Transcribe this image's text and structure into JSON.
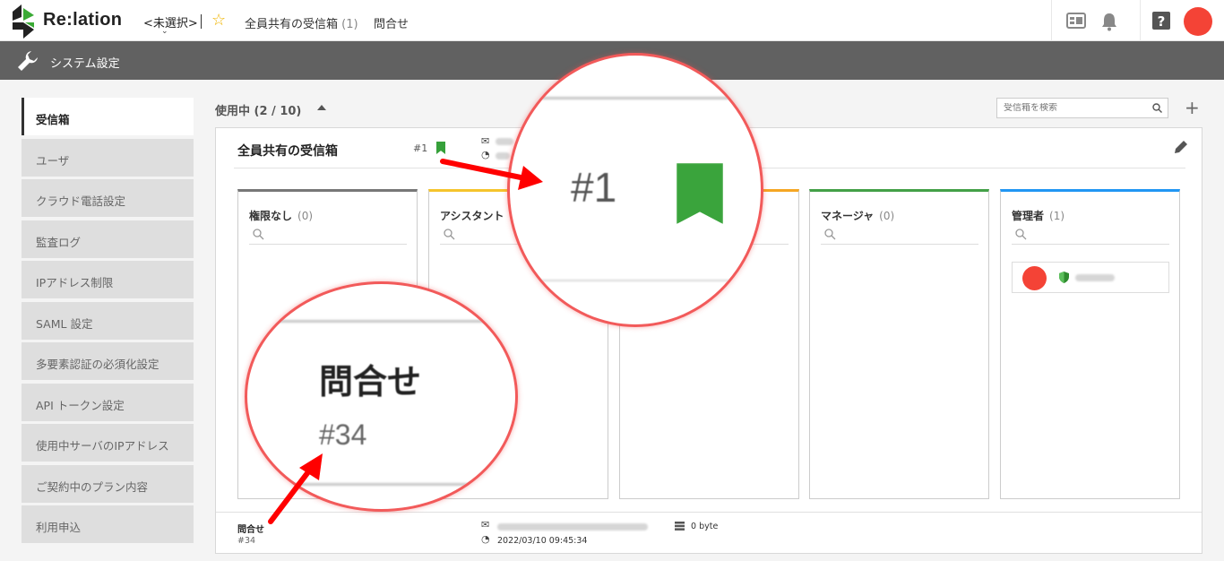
{
  "header": {
    "logo_text": "Re:lation",
    "inbox_selector": "<未選択>",
    "favorites": [
      {
        "label": "全員共有の受信箱",
        "count": "(1)"
      },
      {
        "label": "問合せ",
        "count": ""
      }
    ],
    "icons": [
      "widget-icon",
      "bell-icon",
      "help-icon",
      "avatar"
    ]
  },
  "subbar": {
    "title": "システム設定"
  },
  "sidebar": {
    "items": [
      {
        "label": "受信箱",
        "active": true
      },
      {
        "label": "ユーザ"
      },
      {
        "label": "クラウド電話設定"
      },
      {
        "label": "監査ログ"
      },
      {
        "label": "IPアドレス制限"
      },
      {
        "label": "SAML 設定"
      },
      {
        "label": "多要素認証の必須化設定"
      },
      {
        "label": "API トークン設定"
      },
      {
        "label": "使用中サーバのIPアドレス"
      },
      {
        "label": "ご契約中のプラン内容"
      },
      {
        "label": "利用申込"
      }
    ]
  },
  "main": {
    "section_label": "使用中 (2 / 10)",
    "search_placeholder": "受信箱を検索",
    "card": {
      "title": "全員共有の受信箱",
      "number": "#1",
      "roles": [
        {
          "name": "権限なし",
          "count": "(0)",
          "color": "#777777"
        },
        {
          "name": "アシスタント",
          "count": "",
          "color": "#f5c42c"
        },
        {
          "name": "",
          "count": "",
          "color": "#f5a623"
        },
        {
          "name": "マネージャ",
          "count": "(0)",
          "color": "#43a047"
        },
        {
          "name": "管理者",
          "count": "(1)",
          "color": "#2196f3"
        }
      ]
    },
    "footer": {
      "title": "問合せ",
      "number": "#34",
      "date": "2022/03/10 09:45:34",
      "size": "0 byte"
    }
  },
  "zoom": {
    "number_zoom": "#1",
    "title_zoom": "問合せ",
    "sub_zoom": "#34"
  },
  "colors": {
    "accent_red": "#f44336",
    "bookmark_green": "#36a03a",
    "subbar_gray": "#616161"
  }
}
